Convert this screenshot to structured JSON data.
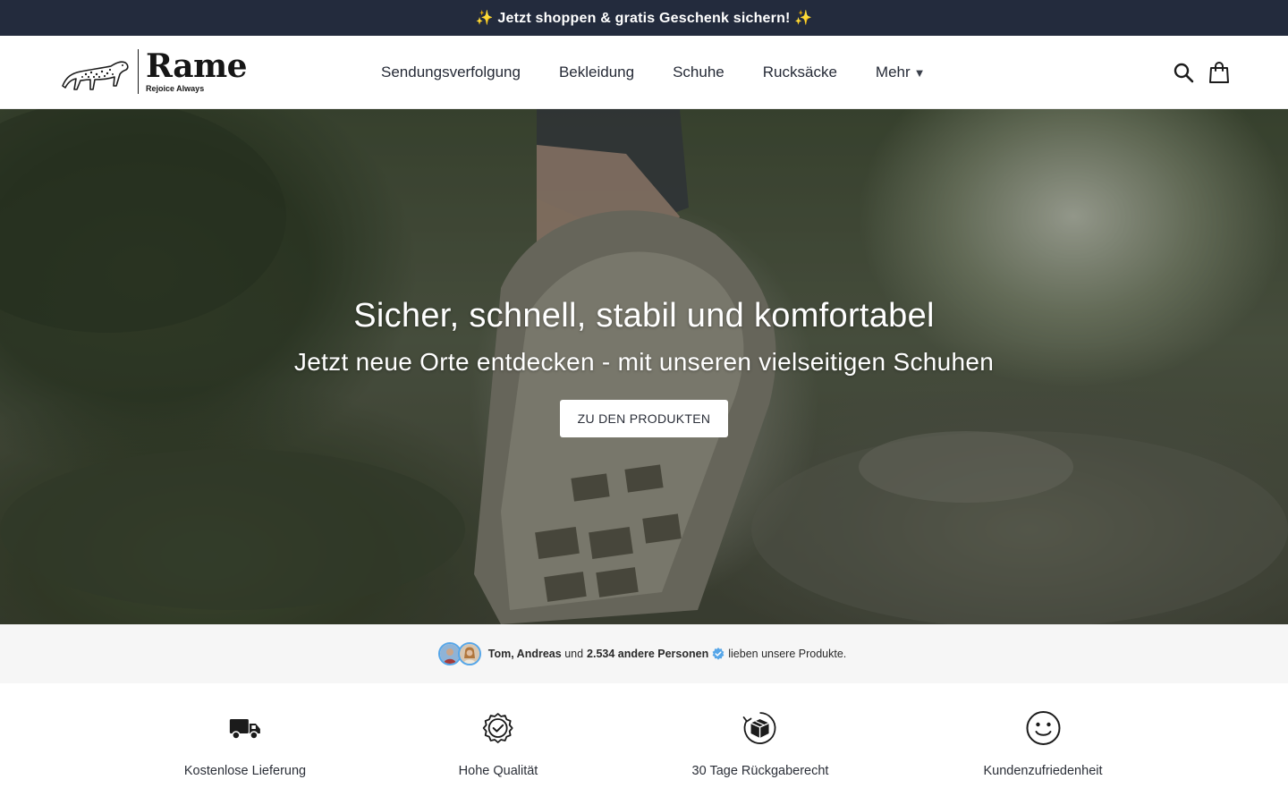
{
  "announcement": {
    "text": "✨ Jetzt shoppen & gratis Geschenk sichern! ✨"
  },
  "brand": {
    "name": "Rame",
    "tagline": "Rejoice Always"
  },
  "nav": {
    "items": [
      {
        "label": "Sendungsverfolgung"
      },
      {
        "label": "Bekleidung"
      },
      {
        "label": "Schuhe"
      },
      {
        "label": "Rucksäcke"
      },
      {
        "label": "Mehr"
      }
    ],
    "more_caret": "▼"
  },
  "header_icons": {
    "search": "search-icon",
    "cart": "shopping-bag-icon"
  },
  "hero": {
    "title": "Sicher, schnell, stabil und komfortabel",
    "subtitle": "Jetzt neue Orte entdecken - mit unseren vielseitigen Schuhen",
    "cta_label": "ZU DEN PRODUKTEN"
  },
  "social_proof": {
    "names": "Tom, Andreas",
    "connector": "und",
    "count_text": "2.534 andere Personen",
    "suffix": "lieben unsere Produkte."
  },
  "features": [
    {
      "icon": "truck-icon",
      "label": "Kostenlose Lieferung"
    },
    {
      "icon": "quality-badge-icon",
      "label": "Hohe Qualität"
    },
    {
      "icon": "return-box-icon",
      "label": "30 Tage Rückgaberecht"
    },
    {
      "icon": "smiley-icon",
      "label": "Kundenzufriedenheit"
    }
  ],
  "colors": {
    "announcement_bg": "#232b3d",
    "verified_blue": "#56a6e8"
  }
}
